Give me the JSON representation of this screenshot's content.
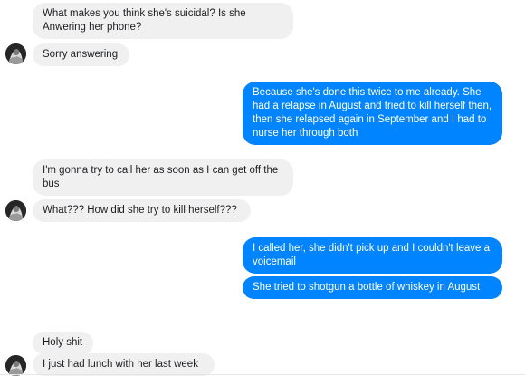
{
  "conversation": {
    "messages": [
      {
        "id": "m1",
        "side": "incoming",
        "text": "What makes you think she's suicidal? Is she Anwering her phone?"
      },
      {
        "id": "m2",
        "side": "incoming",
        "text": "Sorry answering"
      },
      {
        "id": "m3",
        "side": "outgoing",
        "text": "Because she's done this twice to me already. She had a relapse in August and tried to kill herself then, then she relapsed again in September and I had to nurse her through both"
      },
      {
        "id": "m4",
        "side": "incoming",
        "text": "I'm gonna try to call her as soon as I can get off the bus"
      },
      {
        "id": "m5",
        "side": "incoming",
        "text": "What??? How did she try to kill herself???"
      },
      {
        "id": "m6",
        "side": "outgoing",
        "text": "I called her, she didn't pick up and I couldn't leave a voicemail"
      },
      {
        "id": "m7",
        "side": "outgoing",
        "text": "She tried to shotgun a bottle of whiskey in August"
      },
      {
        "id": "m8",
        "side": "incoming",
        "text": "Holy shit"
      },
      {
        "id": "m9",
        "side": "incoming",
        "text": "I just had lunch with her last week"
      }
    ]
  },
  "colors": {
    "incoming_bubble": "#f1f0f0",
    "outgoing_bubble": "#0084ff",
    "avatar": "#262626"
  },
  "icons": {
    "avatar": "contact-avatar-icon"
  }
}
